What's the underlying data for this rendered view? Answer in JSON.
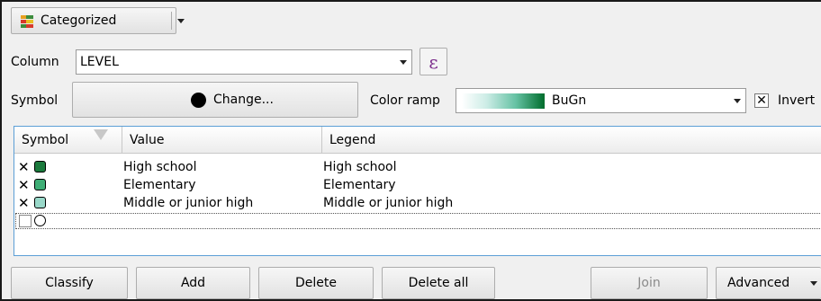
{
  "renderer": {
    "type_label": "Categorized",
    "type_icon": "categorized-renderer-icon"
  },
  "column": {
    "label": "Column",
    "value": "LEVEL",
    "expression_symbol": "ε"
  },
  "symbol": {
    "label": "Symbol",
    "change_label": "Change...",
    "symbol_color": "#000000"
  },
  "color_ramp": {
    "label": "Color ramp",
    "value": "BuGn",
    "invert_label": "Invert",
    "invert_checked": true
  },
  "table": {
    "headers": [
      "Symbol",
      "Value",
      "Legend"
    ],
    "rows": [
      {
        "checked": true,
        "color": "#1b7a3c",
        "value": "High school",
        "legend": "High school"
      },
      {
        "checked": true,
        "color": "#3fae76",
        "value": "Elementary",
        "legend": "Elementary"
      },
      {
        "checked": true,
        "color": "#99d8c9",
        "value": "Middle or junior high",
        "legend": "Middle or junior high"
      },
      {
        "checked": false,
        "color": "#ffffff",
        "value": "",
        "legend": ""
      }
    ]
  },
  "buttons": {
    "classify": "Classify",
    "add": "Add",
    "delete": "Delete",
    "delete_all": "Delete all",
    "join": "Join",
    "advanced": "Advanced"
  }
}
